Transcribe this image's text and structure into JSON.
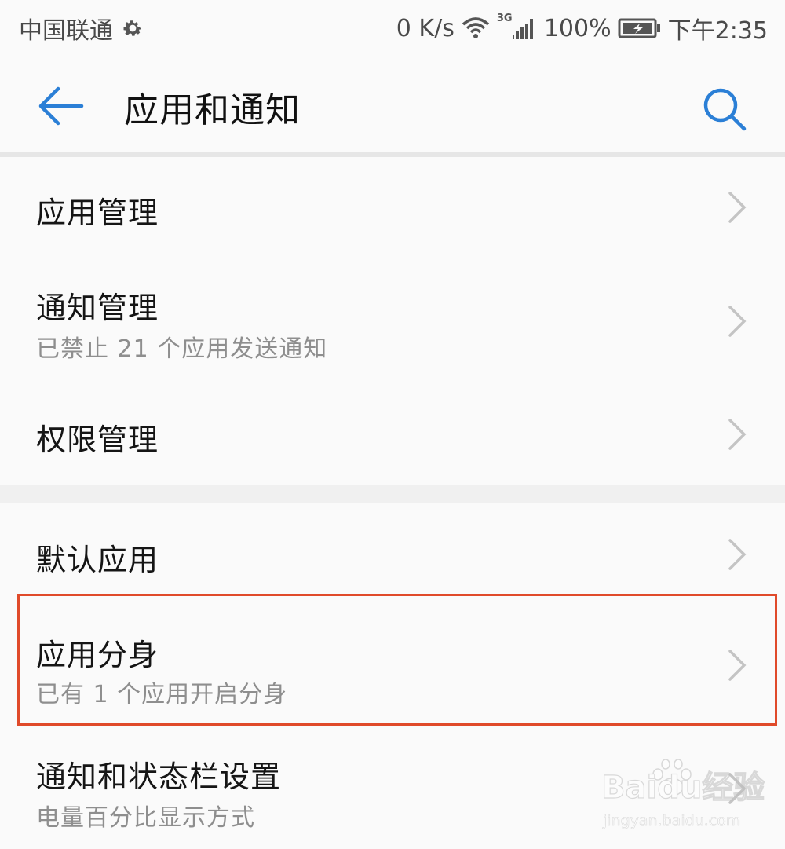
{
  "status_bar": {
    "carrier": "中国联通",
    "speed": "0 K/s",
    "network": "3G",
    "battery": "100%",
    "time": "下午2:35"
  },
  "header": {
    "title": "应用和通知"
  },
  "groups": [
    {
      "items": [
        {
          "title": "应用管理",
          "subtitle": ""
        },
        {
          "title": "通知管理",
          "subtitle": "已禁止 21 个应用发送通知"
        },
        {
          "title": "权限管理",
          "subtitle": ""
        }
      ]
    },
    {
      "items": [
        {
          "title": "默认应用",
          "subtitle": ""
        },
        {
          "title": "应用分身",
          "subtitle": "已有 1 个应用开启分身"
        },
        {
          "title": "通知和状态栏设置",
          "subtitle": "电量百分比显示方式"
        }
      ]
    }
  ],
  "watermark": {
    "main": "Baidu经验",
    "sub": "jingyan.baidu.com"
  },
  "colors": {
    "accent": "#2b7fd6",
    "highlight": "#e04a2a"
  },
  "icons": {
    "back": "arrow-left-icon",
    "search": "search-icon",
    "chevron": "chevron-right-icon",
    "settings": "gear-icon",
    "wifi": "wifi-icon",
    "signal": "signal-icon",
    "battery": "battery-charging-icon"
  }
}
